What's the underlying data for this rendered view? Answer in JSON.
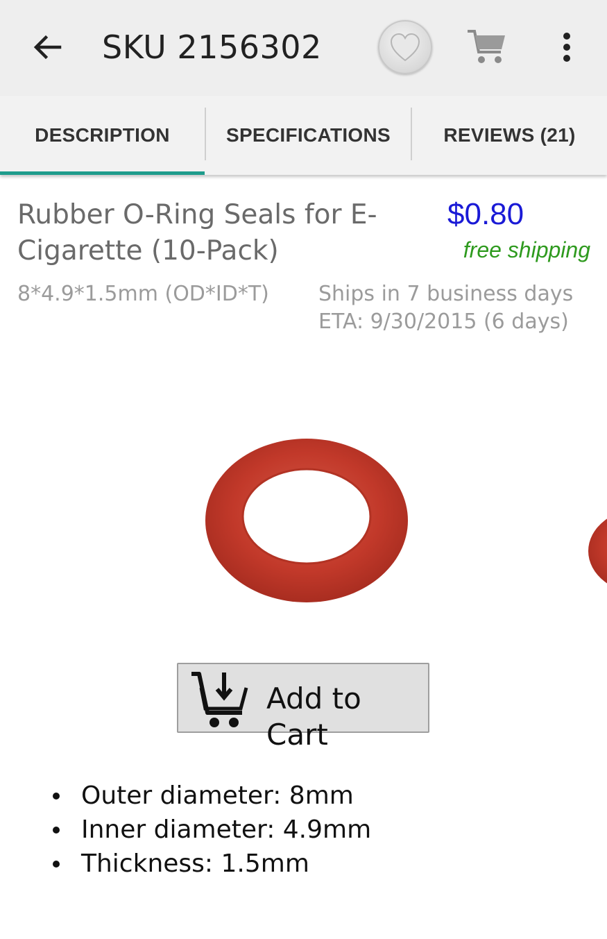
{
  "appbar": {
    "title": "SKU 2156302",
    "icons": [
      "back-arrow-icon",
      "heart-icon",
      "cart-icon",
      "more-vert-icon"
    ]
  },
  "tabs": [
    {
      "label": "DESCRIPTION",
      "active": true
    },
    {
      "label": "SPECIFICATIONS",
      "active": false
    },
    {
      "label": "REVIEWS (21)",
      "active": false
    }
  ],
  "product": {
    "title": "Rubber O-Ring Seals for E-Cigarette (10-Pack)",
    "price": "$0.80",
    "shipping": "free shipping",
    "variant": "8*4.9*1.5mm (OD*ID*T)",
    "ships_in": "Ships in 7 business days",
    "eta": "ETA: 9/30/2015 (6 days)"
  },
  "actions": {
    "add_to_cart_label": "Add to Cart"
  },
  "features": [
    "Outer diameter: 8mm",
    "Inner diameter: 4.9mm",
    "Thickness: 1.5mm"
  ],
  "colors": {
    "accent_teal": "#1e9c8c",
    "price_blue": "#1a1ad6",
    "shipping_green": "#2e9a1e",
    "oring_red": "#c2392a"
  }
}
